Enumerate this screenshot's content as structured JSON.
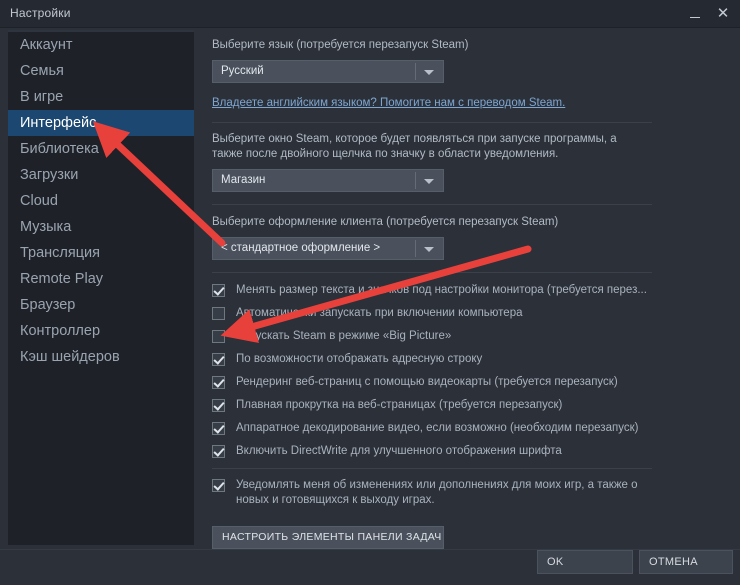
{
  "window": {
    "title": "Настройки",
    "minimize_icon": "minimize-icon",
    "close_icon": "close-icon",
    "close_glyph": "✕"
  },
  "sidebar": {
    "items": [
      {
        "label": "Аккаунт",
        "selected": false
      },
      {
        "label": "Семья",
        "selected": false
      },
      {
        "label": "В игре",
        "selected": false
      },
      {
        "label": "Интерфейс",
        "selected": true
      },
      {
        "label": "Библиотека",
        "selected": false
      },
      {
        "label": "Загрузки",
        "selected": false
      },
      {
        "label": "Cloud",
        "selected": false
      },
      {
        "label": "Музыка",
        "selected": false
      },
      {
        "label": "Трансляция",
        "selected": false
      },
      {
        "label": "Remote Play",
        "selected": false
      },
      {
        "label": "Браузер",
        "selected": false
      },
      {
        "label": "Контроллер",
        "selected": false
      },
      {
        "label": "Кэш шейдеров",
        "selected": false
      }
    ]
  },
  "content": {
    "language_section": {
      "label": "Выберите язык (потребуется перезапуск Steam)",
      "selected": "Русский",
      "link": "Владеете английским языком? Помогите нам с переводом Steam."
    },
    "startup_window_section": {
      "label": "Выберите окно Steam, которое будет появляться при запуске программы, а также после двойного щелчка по значку в области уведомления.",
      "selected": "Магазин"
    },
    "skin_section": {
      "label": "Выберите оформление клиента (потребуется перезапуск Steam)",
      "selected": "< стандартное оформление >"
    },
    "checkboxes": [
      {
        "label": "Менять размер текста и значков под настройки монитора (требуется перез...",
        "checked": true
      },
      {
        "label": "Автоматически запускать при включении компьютера",
        "checked": false
      },
      {
        "label": "Запускать Steam в режиме «Big Picture»",
        "checked": false
      },
      {
        "label": "По возможности отображать адресную строку",
        "checked": true
      },
      {
        "label": "Рендеринг веб-страниц с помощью видеокарты (требуется перезапуск)",
        "checked": true
      },
      {
        "label": "Плавная прокрутка на веб-страницах (требуется перезапуск)",
        "checked": true
      },
      {
        "label": "Аппаратное декодирование видео, если возможно (необходим перезапуск)",
        "checked": true
      },
      {
        "label": "Включить DirectWrite для улучшенного отображения шрифта",
        "checked": true
      }
    ],
    "notify_checkbox": {
      "label": "Уведомлять меня об изменениях или дополнениях для моих игр, а также о новых и готовящихся к выходу играх.",
      "checked": true
    },
    "taskbar_button": "НАСТРОИТЬ ЭЛЕМЕНТЫ ПАНЕЛИ ЗАДАЧ"
  },
  "footer": {
    "ok_label": "OK",
    "cancel_label": "ОТМЕНА"
  },
  "annotations": {
    "arrow_color": "#e8413c",
    "arrows": [
      {
        "name": "arrow-to-interface-tab",
        "points_to": "Интерфейс"
      },
      {
        "name": "arrow-to-address-bar-checkbox",
        "points_to": "По возможности отображать адресную строку"
      }
    ]
  }
}
